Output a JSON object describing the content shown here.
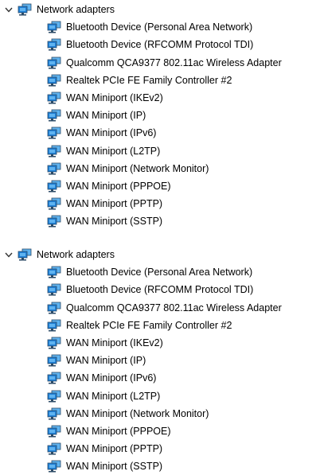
{
  "groups": [
    {
      "expanded": true,
      "category": {
        "label": "Network adapters",
        "icon": "network-adapter-icon"
      },
      "items": [
        {
          "label": "Bluetooth Device (Personal Area Network)",
          "icon": "network-adapter-icon"
        },
        {
          "label": "Bluetooth Device (RFCOMM Protocol TDI)",
          "icon": "network-adapter-icon"
        },
        {
          "label": "Qualcomm QCA9377 802.11ac Wireless Adapter",
          "icon": "network-adapter-icon"
        },
        {
          "label": "Realtek PCIe FE Family Controller #2",
          "icon": "network-adapter-icon"
        },
        {
          "label": "WAN Miniport (IKEv2)",
          "icon": "network-adapter-icon"
        },
        {
          "label": "WAN Miniport (IP)",
          "icon": "network-adapter-icon"
        },
        {
          "label": "WAN Miniport (IPv6)",
          "icon": "network-adapter-icon"
        },
        {
          "label": "WAN Miniport (L2TP)",
          "icon": "network-adapter-icon"
        },
        {
          "label": "WAN Miniport (Network Monitor)",
          "icon": "network-adapter-icon"
        },
        {
          "label": "WAN Miniport (PPPOE)",
          "icon": "network-adapter-icon"
        },
        {
          "label": "WAN Miniport (PPTP)",
          "icon": "network-adapter-icon"
        },
        {
          "label": "WAN Miniport (SSTP)",
          "icon": "network-adapter-icon"
        }
      ]
    },
    {
      "expanded": true,
      "category": {
        "label": "Network adapters",
        "icon": "network-adapter-icon"
      },
      "items": [
        {
          "label": "Bluetooth Device (Personal Area Network)",
          "icon": "network-adapter-icon"
        },
        {
          "label": "Bluetooth Device (RFCOMM Protocol TDI)",
          "icon": "network-adapter-icon"
        },
        {
          "label": "Qualcomm QCA9377 802.11ac Wireless Adapter",
          "icon": "network-adapter-icon"
        },
        {
          "label": "Realtek PCIe FE Family Controller #2",
          "icon": "network-adapter-icon"
        },
        {
          "label": "WAN Miniport (IKEv2)",
          "icon": "network-adapter-icon"
        },
        {
          "label": "WAN Miniport (IP)",
          "icon": "network-adapter-icon"
        },
        {
          "label": "WAN Miniport (IPv6)",
          "icon": "network-adapter-icon"
        },
        {
          "label": "WAN Miniport (L2TP)",
          "icon": "network-adapter-icon"
        },
        {
          "label": "WAN Miniport (Network Monitor)",
          "icon": "network-adapter-icon"
        },
        {
          "label": "WAN Miniport (PPPOE)",
          "icon": "network-adapter-icon"
        },
        {
          "label": "WAN Miniport (PPTP)",
          "icon": "network-adapter-icon"
        },
        {
          "label": "WAN Miniport (SSTP)",
          "icon": "network-adapter-icon"
        }
      ]
    }
  ],
  "colors": {
    "icon_screen": "#1e7fd6",
    "icon_screen_light": "#5fb3f0",
    "icon_base": "#2b4a66",
    "chevron": "#333333",
    "text": "#000000",
    "background": "#ffffff"
  }
}
